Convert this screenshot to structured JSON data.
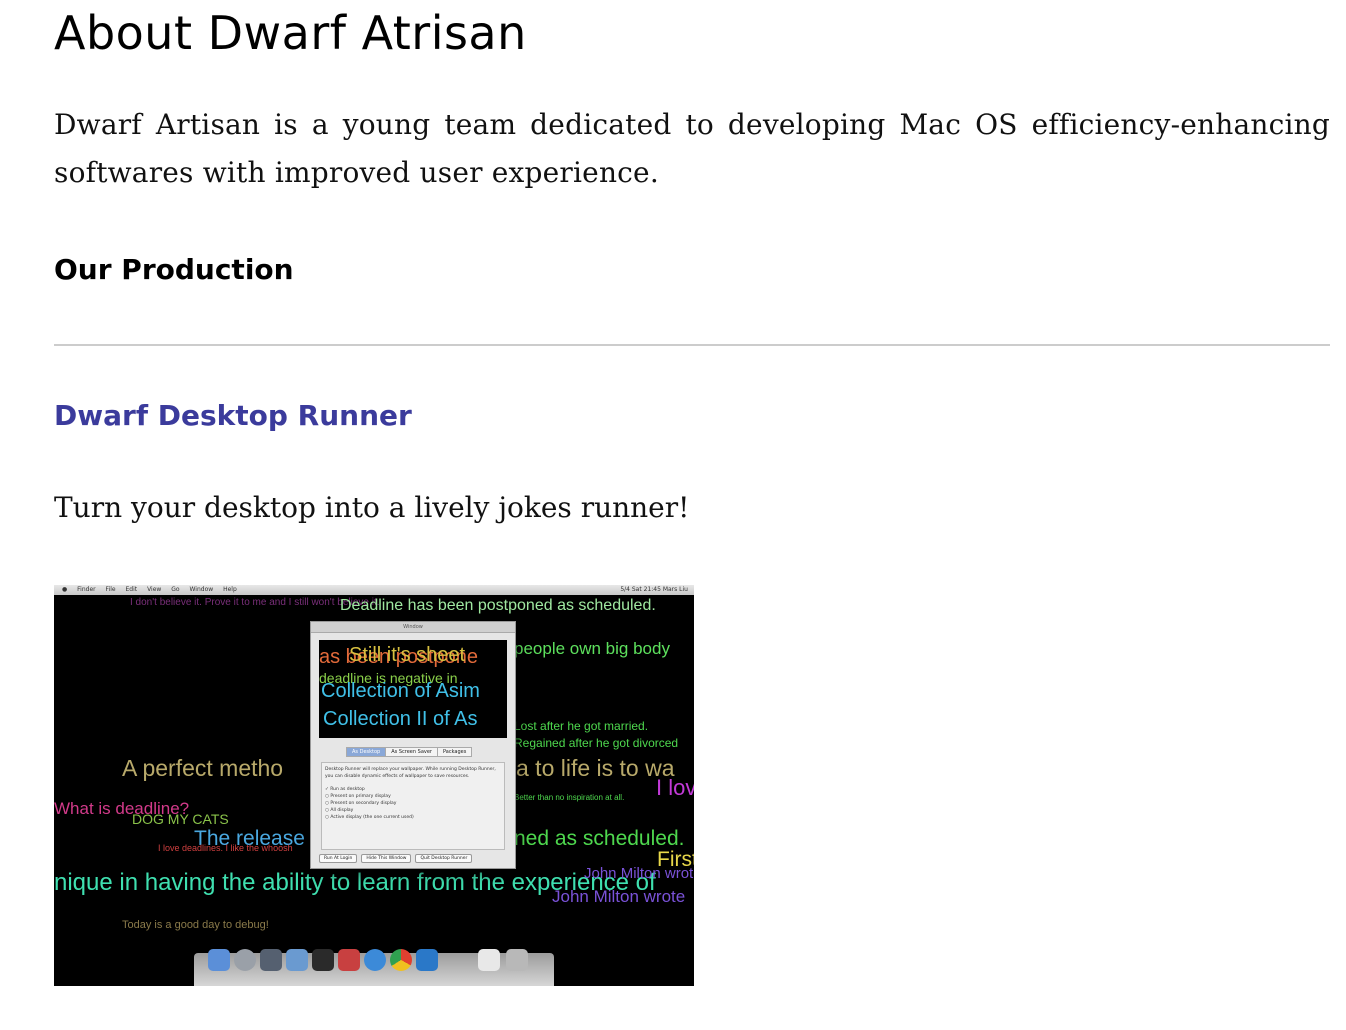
{
  "page": {
    "title": "About Dwarf Atrisan",
    "intro": "Dwarf Artisan is a young team dedicated to developing Mac OS efficiency-enhancing softwares with improved user experience.",
    "section_heading": "Our Production"
  },
  "product": {
    "name": "Dwarf Desktop Runner",
    "tagline": "Turn your desktop into a lively jokes runner!",
    "screenshot": {
      "menubar_left": [
        "Finder",
        "File",
        "Edit",
        "View",
        "Go",
        "Window",
        "Help"
      ],
      "menubar_right": "5/4 Sat 21:45   Mars Liu",
      "jokes": [
        "I don't believe it. Prove it to me and I still won't believe it.",
        "Deadline has been postponed as scheduled.",
        "people own big body",
        "Lost after he got married.",
        "Regained after he got divorced",
        "A perfect metho",
        "a to life is to wa",
        "I lov",
        "What is deadline?",
        "DOG MY CATS",
        "The release",
        "ned as scheduled.",
        "I love deadlines. I like the whoosh",
        "First",
        "nique in having the ability to learn from the experience of",
        "John Milton wrote",
        "John Milton wrote",
        "Better than no inspiration at all.",
        "Today is a good day to debug!"
      ],
      "dialog": {
        "title": "Window",
        "preview_lines": [
          "as been postpone",
          "Still it's sheet",
          "deadline is negative in",
          "Collection of Asim",
          "Collection II of As"
        ],
        "tabs": [
          "As Desktop",
          "As Screen Saver",
          "Packages"
        ],
        "description": "Desktop Runner will replace your wallpaper. While running Desktop Runner, you can disable dynamic effects of wallpaper to save resources.",
        "options": [
          "Run as desktop",
          "Present on primary display",
          "Present on secondary display",
          "All display",
          "Active display (the one current used)"
        ],
        "buttons": [
          "Run At Login",
          "Hide This Window",
          "Quit Desktop Runner"
        ]
      }
    }
  },
  "colors": {
    "heading": "#000000",
    "link": "#3b3b9c",
    "rule": "#cccccc"
  }
}
